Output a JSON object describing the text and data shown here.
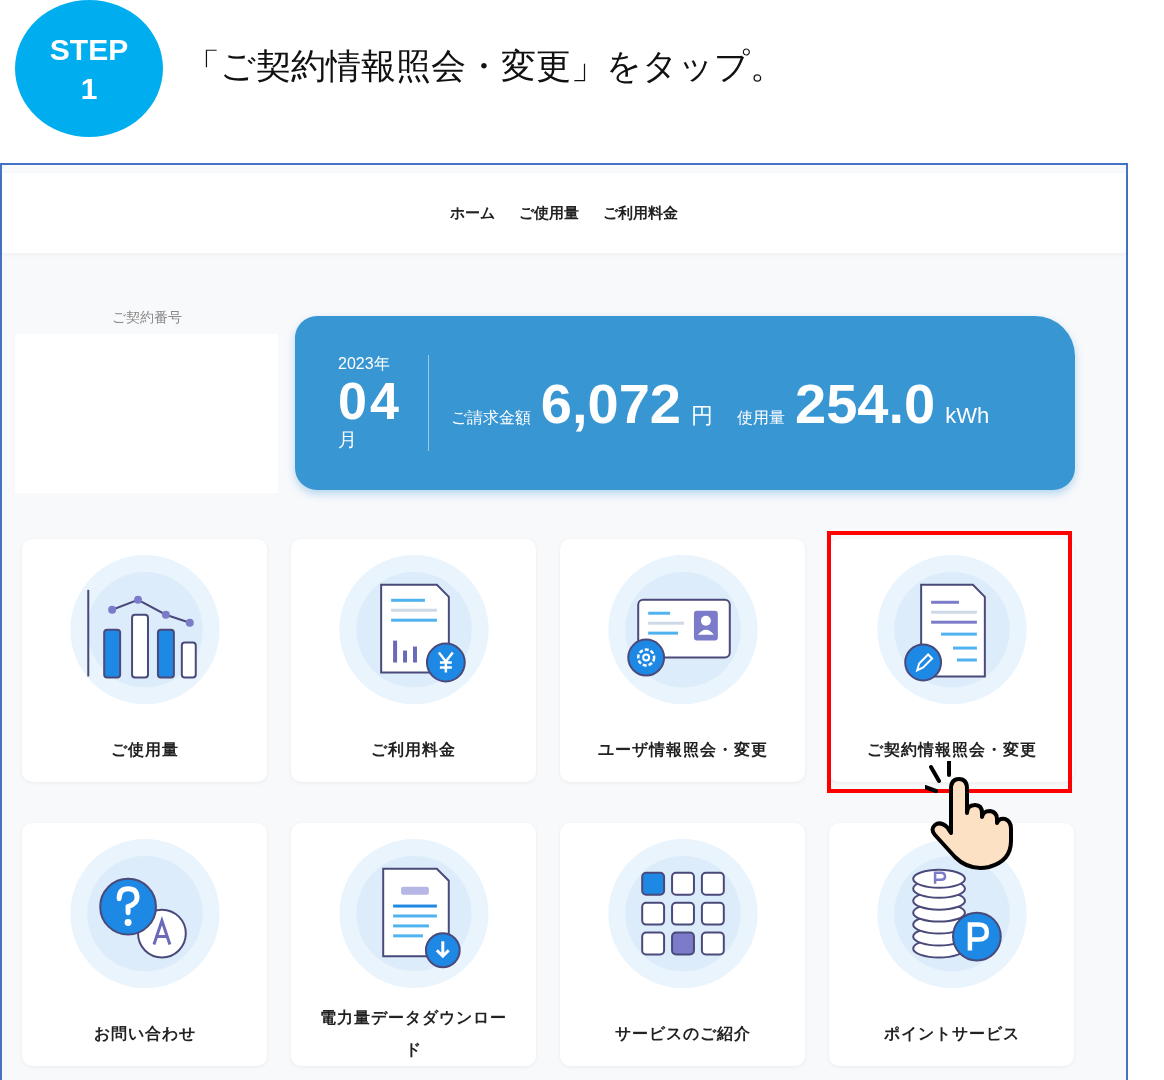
{
  "step": {
    "label": "STEP",
    "number": "1"
  },
  "instruction": "「ご契約情報照会・変更」をタップ。",
  "nav": [
    {
      "label": "ホーム"
    },
    {
      "label": "ご使用量"
    },
    {
      "label": "ご利用料金"
    }
  ],
  "contract": {
    "label": "ご契約番号"
  },
  "summary": {
    "year": "2023年",
    "month": "04",
    "month_unit": "月",
    "billing_label": "ご請求金額",
    "billing_amount": "6,072",
    "billing_unit": "円",
    "usage_label": "使用量",
    "usage_amount": "254.0",
    "usage_unit": "kWh"
  },
  "menu": [
    {
      "label": "ご使用量",
      "kind": "chart",
      "highlighted": false
    },
    {
      "label": "ご利用料金",
      "kind": "bill",
      "highlighted": false
    },
    {
      "label": "ユーザ情報照会・変更",
      "kind": "idcard",
      "highlighted": false
    },
    {
      "label": "ご契約情報照会・変更",
      "kind": "contract",
      "highlighted": true
    },
    {
      "label": "お問い合わせ",
      "kind": "faq",
      "highlighted": false
    },
    {
      "label": "電力量データダウンロード",
      "kind": "csv",
      "highlighted": false
    },
    {
      "label": "サービスのご紹介",
      "kind": "grid",
      "highlighted": false
    },
    {
      "label": "ポイントサービス",
      "kind": "points",
      "highlighted": false
    }
  ]
}
